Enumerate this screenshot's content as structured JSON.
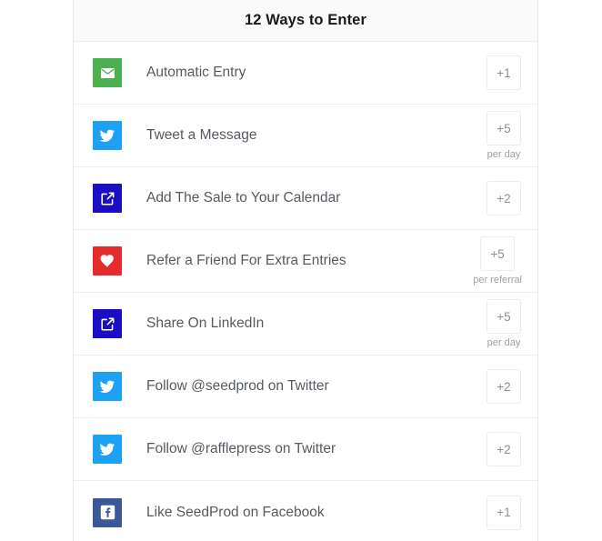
{
  "header": {
    "title": "12 Ways to Enter"
  },
  "colors": {
    "email_green": "#4CAF50",
    "twitter_blue": "#1DA1F2",
    "link_navy": "#1A0DC4",
    "heart_red": "#E52B2B",
    "facebook_blue": "#3B5998",
    "text_gray": "#555b60",
    "points_gray": "#8b9096",
    "border_gray": "#ececec",
    "header_bg": "#fafafa"
  },
  "entries": [
    {
      "label": "Automatic Entry",
      "icon": "envelope-icon",
      "icon_bg": "#4CAF50",
      "points": "+1",
      "points_sub": ""
    },
    {
      "label": "Tweet a Message",
      "icon": "twitter-icon",
      "icon_bg": "#1DA1F2",
      "points": "+5",
      "points_sub": "per day"
    },
    {
      "label": "Add The Sale to Your Calendar",
      "icon": "external-link-icon",
      "icon_bg": "#1A0DC4",
      "points": "+2",
      "points_sub": ""
    },
    {
      "label": "Refer a Friend For Extra Entries",
      "icon": "heart-icon",
      "icon_bg": "#E52B2B",
      "points": "+5",
      "points_sub": "per referral"
    },
    {
      "label": "Share On LinkedIn",
      "icon": "external-link-icon",
      "icon_bg": "#1A0DC4",
      "points": "+5",
      "points_sub": "per day"
    },
    {
      "label": "Follow @seedprod on Twitter",
      "icon": "twitter-icon",
      "icon_bg": "#1DA1F2",
      "points": "+2",
      "points_sub": ""
    },
    {
      "label": "Follow @rafflepress on Twitter",
      "icon": "twitter-icon",
      "icon_bg": "#1DA1F2",
      "points": "+2",
      "points_sub": ""
    },
    {
      "label": "Like SeedProd on Facebook",
      "icon": "facebook-icon",
      "icon_bg": "#3B5998",
      "points": "+1",
      "points_sub": ""
    }
  ]
}
